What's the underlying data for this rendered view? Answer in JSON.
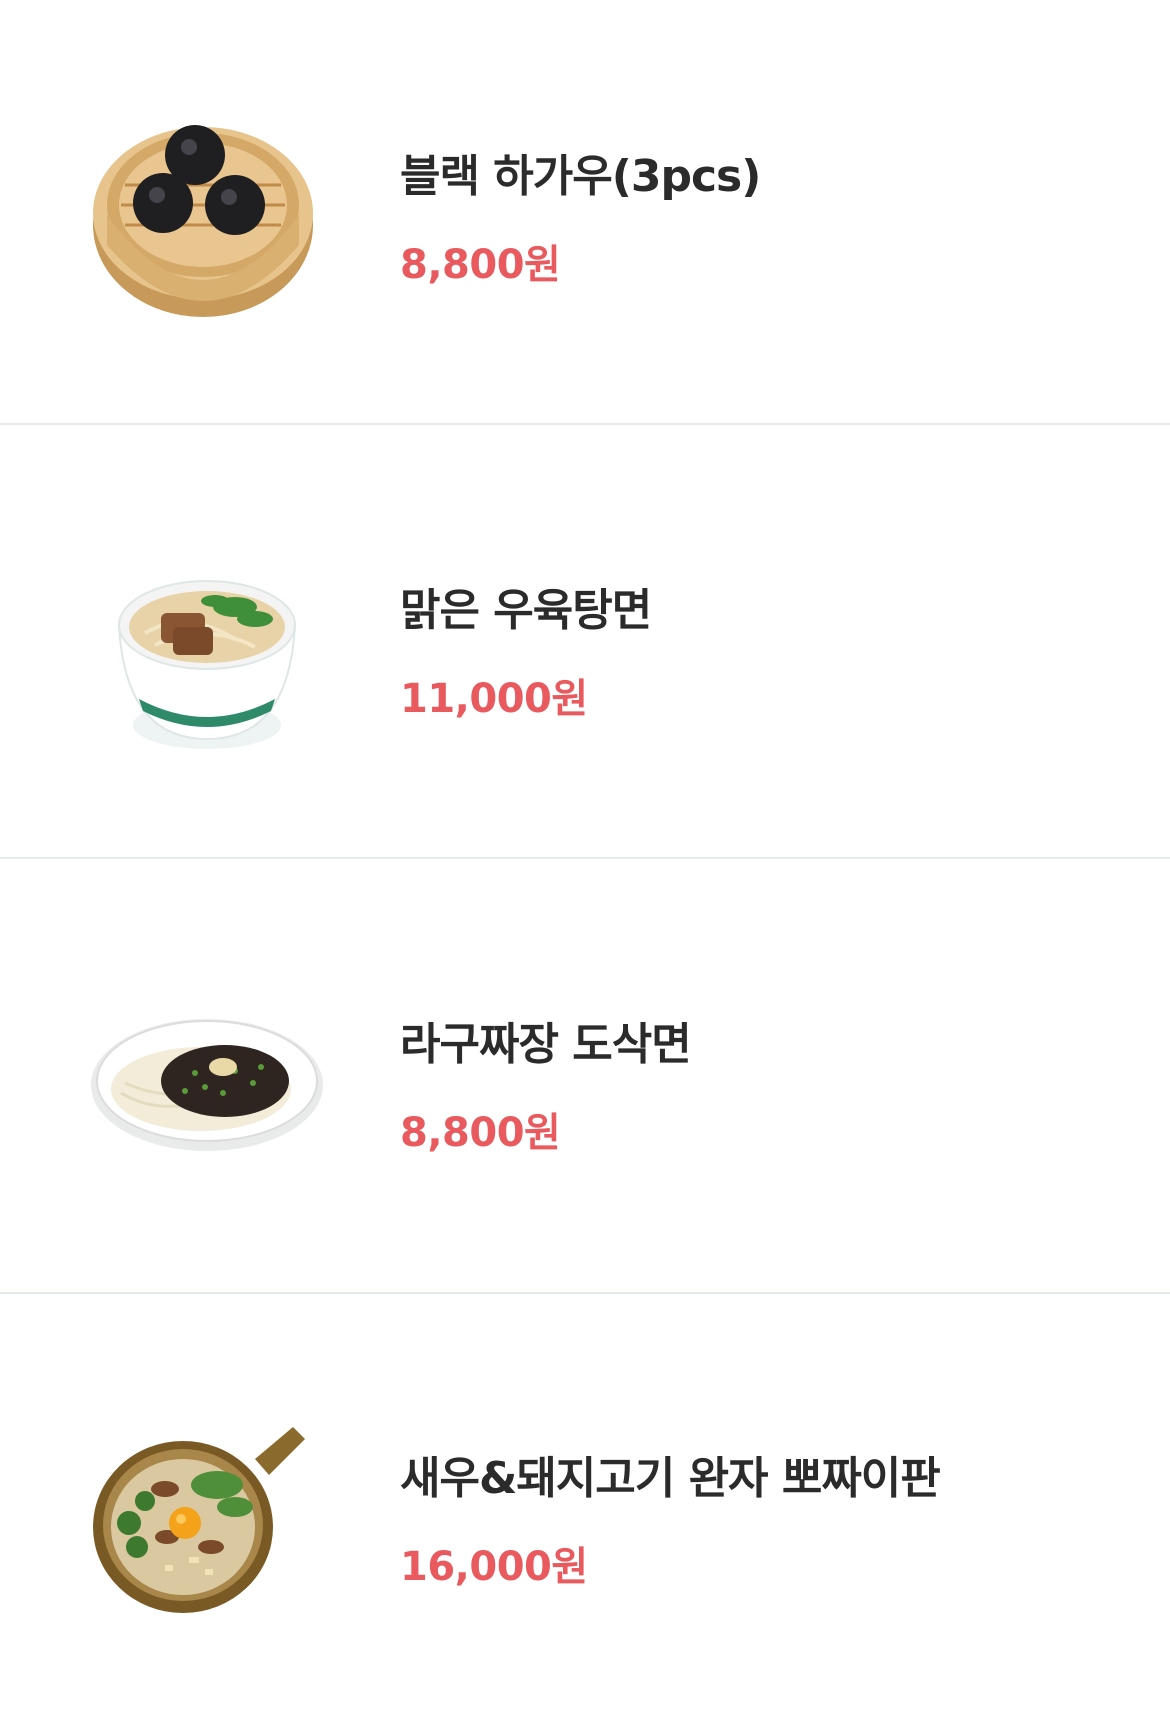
{
  "menu": {
    "items": [
      {
        "name": "블랙 하가우(3pcs)",
        "price": "8,800원",
        "image": "black-har-gow-image"
      },
      {
        "name": "맑은 우육탕면",
        "price": "11,000원",
        "image": "beef-noodle-soup-image"
      },
      {
        "name": "라구짜장 도삭면",
        "price": "8,800원",
        "image": "ragu-jjajang-noodle-image"
      },
      {
        "name": "새우&돼지고기 완자 뽀짜이판",
        "price": "16,000원",
        "image": "claypot-rice-image"
      }
    ]
  },
  "colors": {
    "price": "#e85a5e",
    "title": "#2b2b2b",
    "divider": "#e6ecee"
  }
}
